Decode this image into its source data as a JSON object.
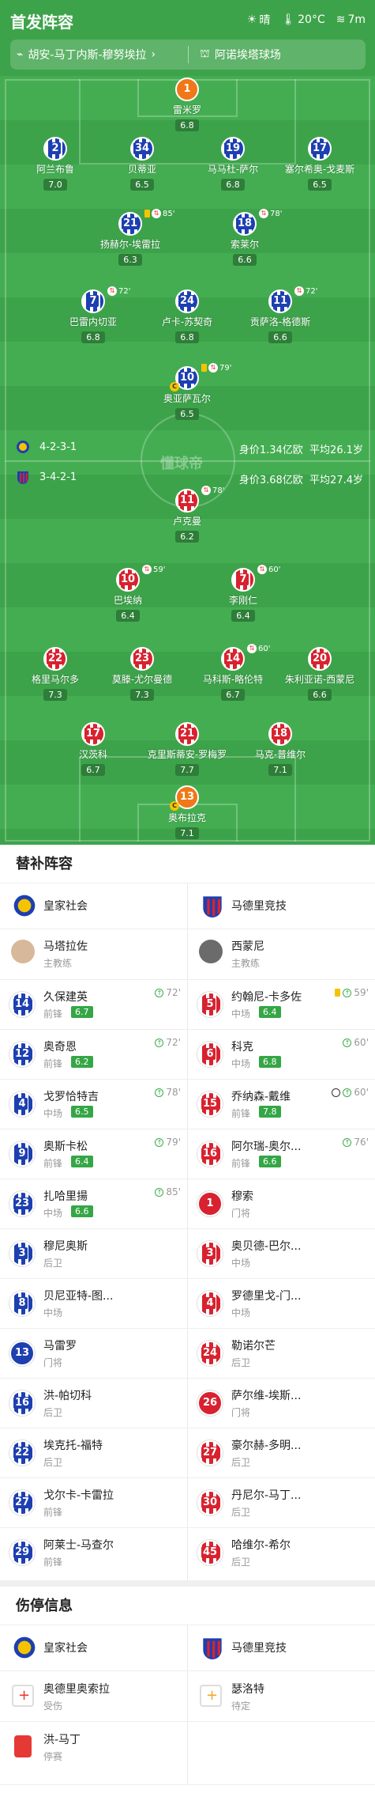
{
  "header": {
    "title": "首发阵容",
    "weather": "晴",
    "temperature": "20°C",
    "wind": "7m",
    "referee": "胡安-马丁内斯-穆努埃拉",
    "venue": "阿诺埃塔球场"
  },
  "home": {
    "formation": "4-2-3-1",
    "value": "身价1.34亿欧",
    "age": "平均26.1岁",
    "players": [
      {
        "num": "1",
        "name": "雷米罗",
        "rating": "6.8",
        "gk": true
      },
      {
        "num": "2",
        "name": "阿兰布鲁",
        "rating": "7.0"
      },
      {
        "num": "34",
        "name": "贝蒂亚",
        "rating": "6.5"
      },
      {
        "num": "19",
        "name": "马马杜-萨尔",
        "rating": "6.8"
      },
      {
        "num": "17",
        "name": "塞尔希奥-戈麦斯",
        "rating": "6.5"
      },
      {
        "num": "21",
        "name": "扬赫尔-埃雷拉",
        "rating": "6.3",
        "ev": "85'"
      },
      {
        "num": "18",
        "name": "索莱尔",
        "rating": "6.6",
        "ev": "78'"
      },
      {
        "num": "7",
        "name": "巴雷内切亚",
        "rating": "6.8",
        "ev": "72'"
      },
      {
        "num": "24",
        "name": "卢卡-苏契奇",
        "rating": "6.8"
      },
      {
        "num": "11",
        "name": "贡萨洛-格德斯",
        "rating": "6.6",
        "ev": "72'"
      },
      {
        "num": "10",
        "name": "奥亚萨瓦尔",
        "rating": "6.5",
        "ev": "79'"
      }
    ]
  },
  "away": {
    "formation": "3-4-2-1",
    "value": "身价3.68亿欧",
    "age": "平均27.4岁",
    "players": [
      {
        "num": "11",
        "name": "卢克曼",
        "rating": "6.2",
        "ev": "78'"
      },
      {
        "num": "10",
        "name": "巴埃纳",
        "rating": "6.4",
        "ev": "59'"
      },
      {
        "num": "7",
        "name": "李刚仁",
        "rating": "6.4",
        "ev": "60'"
      },
      {
        "num": "22",
        "name": "格里马尔多",
        "rating": "7.3"
      },
      {
        "num": "23",
        "name": "莫滕-尤尔曼德",
        "rating": "7.3"
      },
      {
        "num": "14",
        "name": "马科斯-略伦特",
        "rating": "6.7",
        "ev": "60'"
      },
      {
        "num": "20",
        "name": "朱利亚诺-西蒙尼",
        "rating": "6.6"
      },
      {
        "num": "17",
        "name": "汉茨科",
        "rating": "6.7"
      },
      {
        "num": "21",
        "name": "克里斯蒂安-罗梅罗",
        "rating": "7.7"
      },
      {
        "num": "18",
        "name": "马克-普维尔",
        "rating": "7.1"
      },
      {
        "num": "13",
        "name": "奥布拉克",
        "rating": "7.1",
        "gk": true
      }
    ]
  },
  "watermark": "懂球帝",
  "subs": {
    "title": "替补阵容",
    "home_team": "皇家社会",
    "away_team": "马德里竞技",
    "home_coach": "马塔拉佐",
    "away_coach": "西蒙尼",
    "coach_label": "主教练",
    "home": [
      {
        "num": "14",
        "name": "久保建英",
        "pos": "前锋",
        "rating": "6.7",
        "ev": "72'"
      },
      {
        "num": "12",
        "name": "奥奇恩",
        "pos": "前锋",
        "rating": "6.2",
        "ev": "72'"
      },
      {
        "num": "4",
        "name": "戈罗恰特吉",
        "pos": "中场",
        "rating": "6.5",
        "ev": "78'"
      },
      {
        "num": "9",
        "name": "奥斯卡松",
        "pos": "前锋",
        "rating": "6.4",
        "ev": "79'"
      },
      {
        "num": "23",
        "name": "扎哈里揚",
        "pos": "中场",
        "rating": "6.6",
        "ev": "85'"
      },
      {
        "num": "3",
        "name": "穆尼奥斯",
        "pos": "后卫"
      },
      {
        "num": "8",
        "name": "贝尼亚特-图...",
        "pos": "中场"
      },
      {
        "num": "13",
        "name": "马雷罗",
        "pos": "门将"
      },
      {
        "num": "16",
        "name": "洪-帕切科",
        "pos": "后卫"
      },
      {
        "num": "22",
        "name": "埃克托-福特",
        "pos": "后卫"
      },
      {
        "num": "27",
        "name": "戈尔卡-卡雷拉",
        "pos": "前锋"
      },
      {
        "num": "29",
        "name": "阿莱士-马查尔",
        "pos": "前锋"
      }
    ],
    "away": [
      {
        "num": "5",
        "name": "约翰尼-卡多佐",
        "pos": "中场",
        "rating": "6.4",
        "ev": "59'"
      },
      {
        "num": "6",
        "name": "科克",
        "pos": "中场",
        "rating": "6.8",
        "ev": "60'"
      },
      {
        "num": "15",
        "name": "乔纳森-戴维",
        "pos": "前锋",
        "rating": "7.8",
        "ev": "60'"
      },
      {
        "num": "16",
        "name": "阿尔瑞-奥尔...",
        "pos": "前锋",
        "rating": "6.6",
        "ev": "76'"
      },
      {
        "num": "1",
        "name": "穆索",
        "pos": "门将"
      },
      {
        "num": "3",
        "name": "奥贝德-巴尔...",
        "pos": "中场"
      },
      {
        "num": "4",
        "name": "罗德里戈-门...",
        "pos": "中场"
      },
      {
        "num": "24",
        "name": "勒诺尔芒",
        "pos": "后卫"
      },
      {
        "num": "26",
        "name": "萨尔维-埃斯...",
        "pos": "门将"
      },
      {
        "num": "27",
        "name": "豪尔赫-多明...",
        "pos": "后卫"
      },
      {
        "num": "30",
        "name": "丹尼尔-马丁...",
        "pos": "后卫"
      },
      {
        "num": "45",
        "name": "哈维尔-希尔",
        "pos": "后卫"
      }
    ]
  },
  "injuries": {
    "title": "伤停信息",
    "home_team": "皇家社会",
    "away_team": "马德里竞技",
    "home": [
      {
        "name": "奥德里奥索拉",
        "status": "受伤"
      },
      {
        "name": "洪-马丁",
        "status": "停赛"
      }
    ],
    "away": [
      {
        "name": "瑟洛特",
        "status": "待定"
      }
    ]
  }
}
